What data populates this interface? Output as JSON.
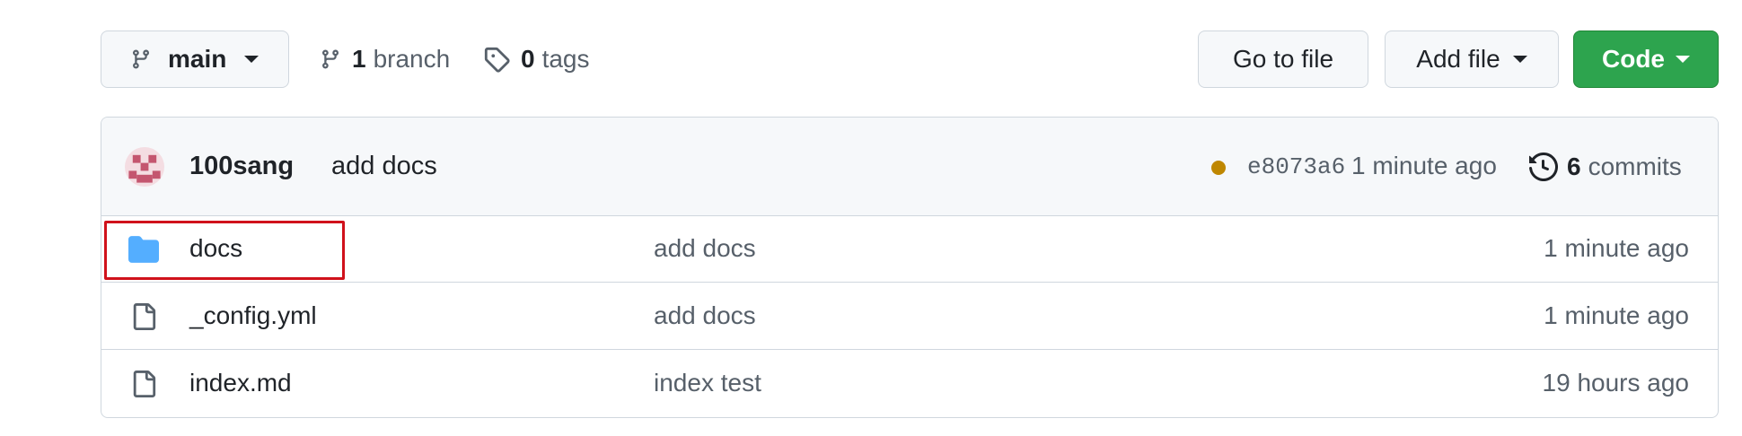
{
  "toolbar": {
    "branch_button": "main",
    "branch_count": "1",
    "branch_word": "branch",
    "tag_count": "0",
    "tag_word": "tags",
    "goto_file": "Go to file",
    "add_file": "Add file",
    "code": "Code"
  },
  "latest_commit": {
    "author": "100sang",
    "message": "add docs",
    "sha": "e8073a6",
    "time": "1 minute ago",
    "commit_count": "6",
    "commit_word": "commits",
    "status_color": "#bf8700"
  },
  "files": [
    {
      "name": "docs",
      "type": "folder",
      "message": "add docs",
      "time": "1 minute ago"
    },
    {
      "name": "_config.yml",
      "type": "file",
      "message": "add docs",
      "time": "1 minute ago"
    },
    {
      "name": "index.md",
      "type": "file",
      "message": "index test",
      "time": "19 hours ago"
    }
  ],
  "colors": {
    "accent_green": "#2da44e",
    "folder_blue": "#54aeff",
    "highlight_red": "#d0111b"
  }
}
